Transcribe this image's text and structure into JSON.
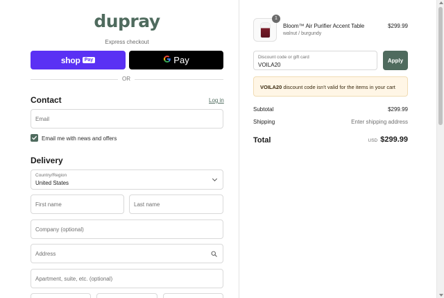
{
  "brand": {
    "logo": "dupray",
    "accent": "#4f6b5e"
  },
  "express": {
    "title": "Express checkout",
    "shop_pay_word": "shop",
    "shop_pay_badge": "Pay",
    "gpay_g": "G",
    "gpay_word": "Pay",
    "or_text": "OR"
  },
  "contact": {
    "heading": "Contact",
    "login_link": "Log in",
    "email_placeholder": "Email",
    "newsletter_label": "Email me with news and offers",
    "newsletter_checked": true
  },
  "delivery": {
    "heading": "Delivery",
    "country_label": "Country/Region",
    "country_value": "United States",
    "first_name_placeholder": "First name",
    "last_name_placeholder": "Last name",
    "company_placeholder": "Company (optional)",
    "address_placeholder": "Address",
    "apartment_placeholder": "Apartment, suite, etc. (optional)"
  },
  "cart": {
    "item": {
      "quantity": "1",
      "name": "Bloom™ Air Purifier Accent Table",
      "variant": "walnut / burgundy",
      "price": "$299.99"
    },
    "discount": {
      "label": "Discount code or gift card",
      "value": "VOILA20",
      "apply_label": "Apply"
    },
    "warning": {
      "code": "VOILA20",
      "message": " discount code isn't valid for the items in your cart"
    },
    "summary": {
      "subtotal_label": "Subtotal",
      "subtotal_value": "$299.99",
      "shipping_label": "Shipping",
      "shipping_value": "Enter shipping address",
      "total_label": "Total",
      "total_currency": "USD",
      "total_value": "$299.99"
    }
  }
}
